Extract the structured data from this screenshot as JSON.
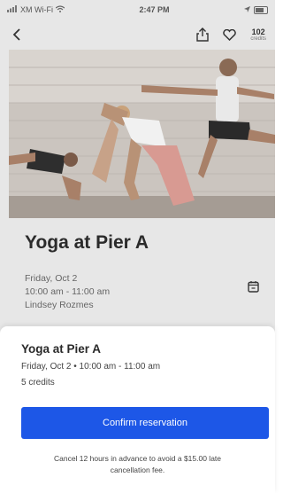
{
  "status_bar": {
    "carrier": "XM Wi-Fi",
    "time": "2:47 PM"
  },
  "nav": {
    "back_icon": "chevron-left-icon",
    "share_icon": "share-icon",
    "favorite_icon": "heart-icon",
    "credits_count": "102",
    "credits_label": "credits"
  },
  "hero": {
    "image": "yoga-class-photo"
  },
  "class": {
    "title": "Yoga at Pier A",
    "date": "Friday, Oct 2",
    "time": "10:00 am - 11:00 am",
    "instructor": "Lindsey Rozmes",
    "calendar_icon": "calendar-icon"
  },
  "sheet": {
    "title": "Yoga at Pier A",
    "datetime": "Friday, Oct 2 • 10:00 am - 11:00 am",
    "credits": "5 credits",
    "confirm_label": "Confirm reservation",
    "cancel_note": "Cancel 12 hours in advance to avoid a $15.00 late cancellation fee."
  },
  "colors": {
    "accent": "#1d57e7",
    "overlay_bg": "#e7e7e7"
  }
}
